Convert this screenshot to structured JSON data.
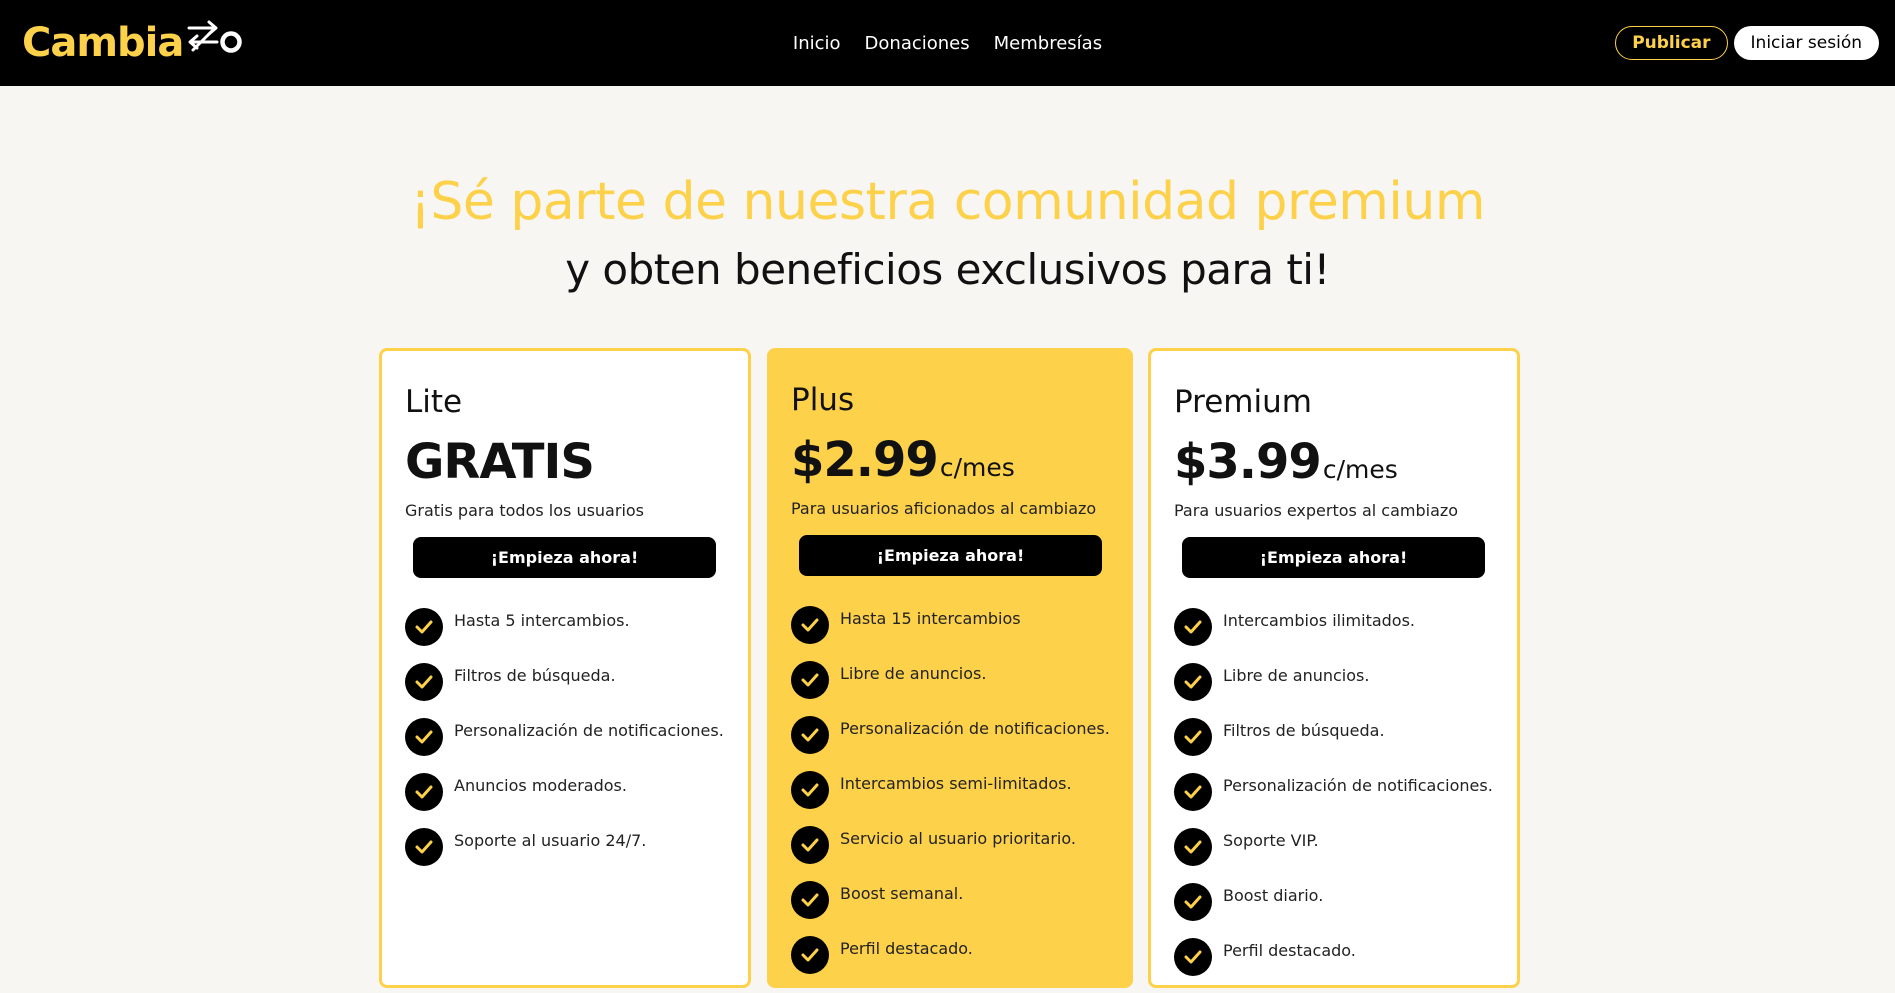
{
  "nav": {
    "logo_text": "Cambia",
    "logo_mark": "arrows-o-logo",
    "links": [
      "Inicio",
      "Donaciones",
      "Membresías"
    ],
    "publicar": "Publicar",
    "login": "Iniciar sesión"
  },
  "hero": {
    "title": "¡Sé parte de nuestra comunidad premium",
    "subtitle": "y obten beneficios exclusivos para ti!"
  },
  "colors": {
    "accent": "#fdd14a",
    "black": "#000000",
    "background": "#f7f6f3"
  },
  "plans": [
    {
      "name": "Lite",
      "price": "GRATIS",
      "per": "",
      "desc": "Gratis para todos los usuarios",
      "cta": "¡Empieza ahora!",
      "features": [
        "Hasta 5 intercambios.",
        "Filtros de búsqueda.",
        "Personalización de notificaciones.",
        "Anuncios moderados.",
        "Soporte al usuario 24/7."
      ]
    },
    {
      "name": "Plus",
      "price": "$2.99",
      "per": "c/mes",
      "desc": "Para usuarios aficionados al cambiazo",
      "cta": "¡Empieza ahora!",
      "features": [
        "Hasta 15 intercambios",
        "Libre de anuncios.",
        "Personalización de notificaciones.",
        "Intercambios semi-limitados.",
        "Servicio al usuario prioritario.",
        "Boost semanal.",
        "Perfil destacado."
      ]
    },
    {
      "name": "Premium",
      "price": "$3.99",
      "per": "c/mes",
      "desc": "Para usuarios expertos al cambiazo",
      "cta": "¡Empieza ahora!",
      "features": [
        "Intercambios ilimitados.",
        "Libre de anuncios.",
        "Filtros de búsqueda.",
        "Personalización de notificaciones.",
        "Soporte VIP.",
        "Boost diario.",
        "Perfil destacado."
      ]
    }
  ]
}
